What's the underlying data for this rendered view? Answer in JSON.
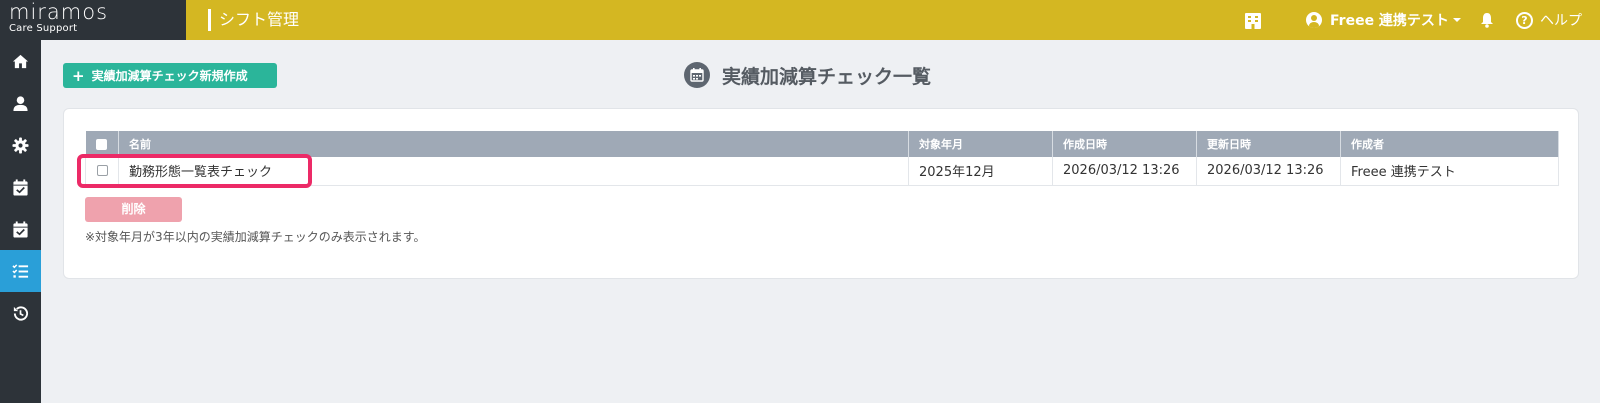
{
  "brand": {
    "name": "miramos",
    "sub": "Care Support"
  },
  "header": {
    "app_title": "シフト管理",
    "user_name": "Freee 連携テスト",
    "help_label": "ヘルプ",
    "help_glyph": "?"
  },
  "sidebar": {
    "items": [
      {
        "icon": "home-icon",
        "active": false
      },
      {
        "icon": "user-icon",
        "active": false
      },
      {
        "icon": "gear-icon",
        "active": false
      },
      {
        "icon": "calendar-check-icon",
        "active": false
      },
      {
        "icon": "calendar-check-icon",
        "active": false
      },
      {
        "icon": "checklist-icon",
        "active": true
      },
      {
        "icon": "history-icon",
        "active": false
      }
    ]
  },
  "main": {
    "new_button_label": "実績加減算チェック新規作成",
    "page_title": "実績加減算チェック一覧",
    "table": {
      "headers": [
        "名前",
        "対象年月",
        "作成日時",
        "更新日時",
        "作成者"
      ],
      "rows": [
        [
          "勤務形態一覧表チェック",
          "2025年12月",
          "2026/03/12 13:26",
          "2026/03/12 13:26",
          "Freee 連携テスト"
        ]
      ]
    },
    "delete_button_label": "削除",
    "note": "※対象年月が3年以内の実績加減算チェックのみ表示されます。"
  },
  "colors": {
    "topbar": "#d4b722",
    "sidebar": "#2d3339",
    "active": "#2a9fd8",
    "primary_button": "#2bb59a",
    "delete_button": "#efa2ad",
    "highlight": "#ec2a67",
    "table_header": "#9fa9b6"
  }
}
